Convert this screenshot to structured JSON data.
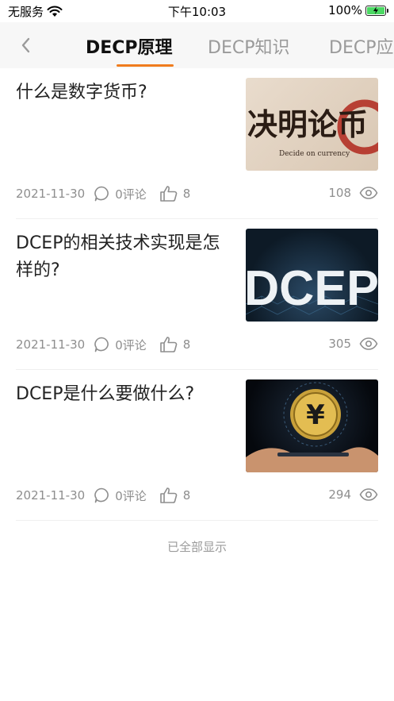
{
  "status_bar": {
    "carrier": "无服务",
    "time": "下午10:03",
    "battery": "100%"
  },
  "nav": {
    "tabs": [
      {
        "label": "DECP原理"
      },
      {
        "label": "DECP知识"
      },
      {
        "label": "DECP应"
      }
    ],
    "accent_color": "#f07c1e"
  },
  "articles": [
    {
      "title": "什么是数字货币?",
      "date": "2021-11-30",
      "comments": "0评论",
      "likes": "8",
      "views": "108",
      "thumb_text": "决明论币",
      "thumb_caption": "Decide on currency"
    },
    {
      "title": "DCEP的相关技术实现是怎样的?",
      "date": "2021-11-30",
      "comments": "0评论",
      "likes": "8",
      "views": "305",
      "thumb_text": "DCEP"
    },
    {
      "title": "DCEP是什么要做什么?",
      "date": "2021-11-30",
      "comments": "0评论",
      "likes": "8",
      "views": "294",
      "thumb_text": "¥"
    }
  ],
  "footer": {
    "text": "已全部显示"
  }
}
